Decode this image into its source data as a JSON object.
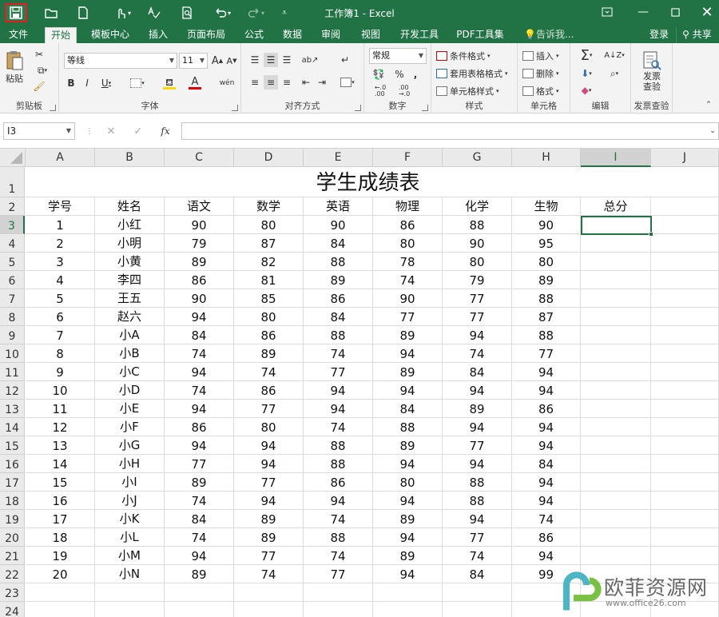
{
  "window": {
    "title": "工作簿1 - Excel"
  },
  "tabs": [
    "文件",
    "开始",
    "模板中心",
    "插入",
    "页面布局",
    "公式",
    "数据",
    "审阅",
    "视图",
    "开发工具",
    "PDF工具集"
  ],
  "tell_me": "告诉我...",
  "login": "登录",
  "share": "共享",
  "ribbon": {
    "clipboard": {
      "label": "剪贴板",
      "paste": "粘贴"
    },
    "font": {
      "label": "字体",
      "name": "等线",
      "size": "11",
      "bold": "B",
      "italic": "I",
      "underline": "U",
      "grow": "A",
      "shrink": "A",
      "phonetic": "wén"
    },
    "alignment": {
      "label": "对齐方式"
    },
    "number": {
      "label": "数字",
      "format": "常规",
      "percent": "%",
      "comma": ","
    },
    "styles": {
      "label": "样式",
      "conditional": "条件格式",
      "table": "套用表格格式",
      "cell": "单元格样式"
    },
    "cells": {
      "label": "单元格",
      "insert": "插入",
      "delete": "删除",
      "format": "格式"
    },
    "editing": {
      "label": "编辑"
    },
    "invoice": {
      "label": "发票查验",
      "button_line1": "发票",
      "button_line2": "查验"
    }
  },
  "formula_bar": {
    "name_box": "I3",
    "fx": "fx",
    "value": ""
  },
  "columns": [
    "A",
    "B",
    "C",
    "D",
    "E",
    "F",
    "G",
    "H",
    "I",
    "J"
  ],
  "selected_column": "I",
  "rows": [
    "1",
    "2",
    "3",
    "4",
    "5",
    "6",
    "7",
    "8",
    "9",
    "10",
    "11",
    "12",
    "13",
    "14",
    "15",
    "16",
    "17",
    "18",
    "19",
    "20",
    "21",
    "22",
    "23",
    "24"
  ],
  "selected_row": "3",
  "sheet": {
    "title": "学生成绩表",
    "headers": [
      "学号",
      "姓名",
      "语文",
      "数学",
      "英语",
      "物理",
      "化学",
      "生物",
      "总分"
    ],
    "data": [
      [
        "1",
        "小红",
        "90",
        "80",
        "90",
        "86",
        "88",
        "90"
      ],
      [
        "2",
        "小明",
        "79",
        "87",
        "84",
        "80",
        "90",
        "95"
      ],
      [
        "3",
        "小黄",
        "89",
        "82",
        "88",
        "78",
        "80",
        "80"
      ],
      [
        "4",
        "李四",
        "86",
        "81",
        "89",
        "74",
        "79",
        "89"
      ],
      [
        "5",
        "王五",
        "90",
        "85",
        "86",
        "90",
        "77",
        "88"
      ],
      [
        "6",
        "赵六",
        "94",
        "80",
        "84",
        "77",
        "77",
        "87"
      ],
      [
        "7",
        "小A",
        "84",
        "86",
        "88",
        "89",
        "94",
        "88"
      ],
      [
        "8",
        "小B",
        "74",
        "89",
        "74",
        "94",
        "74",
        "77"
      ],
      [
        "9",
        "小C",
        "94",
        "74",
        "77",
        "89",
        "84",
        "94"
      ],
      [
        "10",
        "小D",
        "74",
        "86",
        "94",
        "94",
        "94",
        "94"
      ],
      [
        "11",
        "小E",
        "94",
        "77",
        "94",
        "84",
        "89",
        "86"
      ],
      [
        "12",
        "小F",
        "86",
        "80",
        "74",
        "88",
        "94",
        "94"
      ],
      [
        "13",
        "小G",
        "94",
        "94",
        "88",
        "89",
        "77",
        "94"
      ],
      [
        "14",
        "小H",
        "77",
        "94",
        "88",
        "94",
        "94",
        "84"
      ],
      [
        "15",
        "小I",
        "89",
        "77",
        "86",
        "80",
        "88",
        "94"
      ],
      [
        "16",
        "小J",
        "74",
        "94",
        "94",
        "94",
        "88",
        "94"
      ],
      [
        "17",
        "小K",
        "84",
        "89",
        "74",
        "89",
        "94",
        "74"
      ],
      [
        "18",
        "小L",
        "74",
        "89",
        "88",
        "94",
        "77",
        "86"
      ],
      [
        "19",
        "小M",
        "94",
        "77",
        "74",
        "89",
        "74",
        "94"
      ],
      [
        "20",
        "小N",
        "89",
        "74",
        "77",
        "94",
        "84",
        "99"
      ]
    ]
  },
  "watermark": {
    "cn": "欧菲资源网",
    "url": "www.office26.com"
  },
  "colors": {
    "accent": "#217346",
    "selection": "#217346",
    "save_highlight": "#e02020"
  }
}
